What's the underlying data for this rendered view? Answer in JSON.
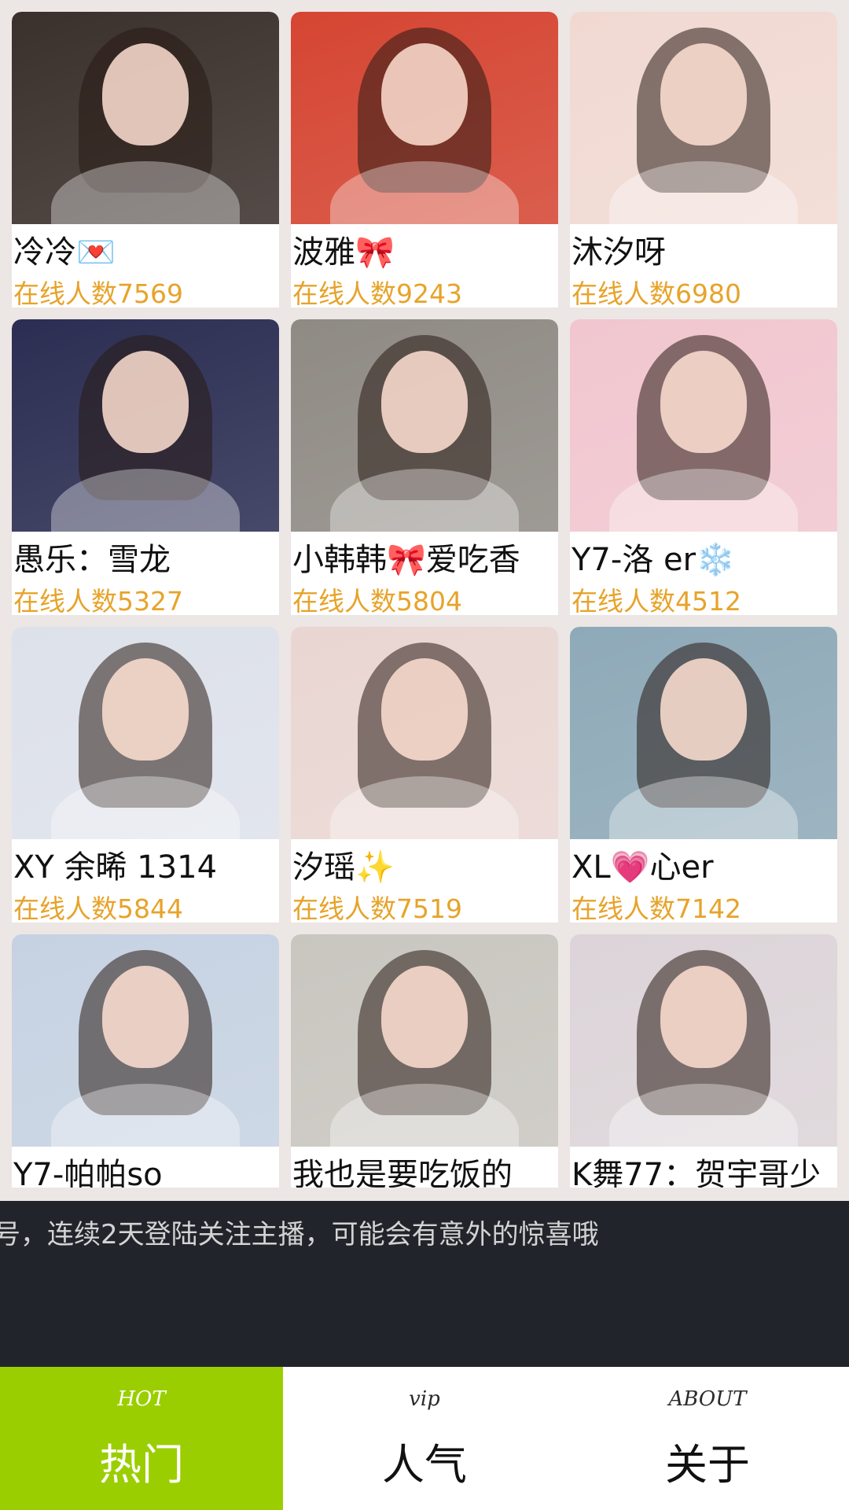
{
  "streams": [
    {
      "name": "冷冷💌",
      "online": "在线人数7569",
      "tone": "#3a302c"
    },
    {
      "name": "波雅🎀",
      "online": "在线人数9243",
      "tone": "#d54532"
    },
    {
      "name": "沐汐呀",
      "online": "在线人数6980",
      "tone": "#f1d9d2"
    },
    {
      "name": "愚乐：雪龙",
      "online": "在线人数5327",
      "tone": "#2b2d52"
    },
    {
      "name": "小韩韩🎀爱吃香",
      "online": "在线人数5804",
      "tone": "#8f8a84"
    },
    {
      "name": "Y7-洛 er❄️",
      "online": "在线人数4512",
      "tone": "#f1c6cf"
    },
    {
      "name": "XY 余晞 1314",
      "online": "在线人数5844",
      "tone": "#dde1ea"
    },
    {
      "name": "汐瑶✨",
      "online": "在线人数7519",
      "tone": "#e9d6d2"
    },
    {
      "name": "XL💗心er",
      "online": "在线人数7142",
      "tone": "#8ea9b8"
    },
    {
      "name": "Y7-帕帕so",
      "online": "",
      "tone": "#c6d2e2"
    },
    {
      "name": "我也是要吃饭的",
      "online": "",
      "tone": "#c9c6c0"
    },
    {
      "name": "K舞77：贺宇哥少",
      "online": "",
      "tone": "#dcd4d8"
    }
  ],
  "ticker": {
    "text": "号，连续2天登陆关注主播，可能会有意外的惊喜哦"
  },
  "tabs": [
    {
      "sub": "HOT",
      "label": "热门",
      "active": true
    },
    {
      "sub": "vip",
      "label": "人气",
      "active": false
    },
    {
      "sub": "ABOUT",
      "label": "关于",
      "active": false
    }
  ]
}
